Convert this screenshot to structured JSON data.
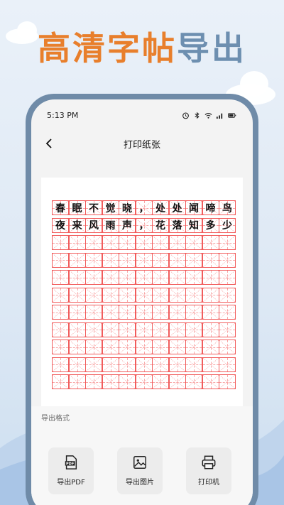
{
  "banner": {
    "title_part1": "高清字帖",
    "title_part2": "导出"
  },
  "status_bar": {
    "time": "5:13 PM"
  },
  "nav": {
    "title": "打印纸张"
  },
  "practice_sheet": {
    "rows": [
      [
        "春",
        "眠",
        "不",
        "觉",
        "晓",
        "，",
        "处",
        "处",
        "闻",
        "啼",
        "鸟"
      ],
      [
        "夜",
        "来",
        "风",
        "雨",
        "声",
        "，",
        "花",
        "落",
        "知",
        "多",
        "少"
      ]
    ],
    "total_rows": 11,
    "columns": 11,
    "grid_color": "#f15c5c"
  },
  "export_panel": {
    "label": "导出格式",
    "options": [
      {
        "label": "导出PDF",
        "icon": "pdf-file-icon"
      },
      {
        "label": "导出图片",
        "icon": "image-icon"
      },
      {
        "label": "打印机",
        "icon": "printer-icon"
      }
    ]
  },
  "colors": {
    "frame": "#6f8ba8",
    "headline_orange": "#e87f2c",
    "headline_blue": "#6d8fb0"
  }
}
